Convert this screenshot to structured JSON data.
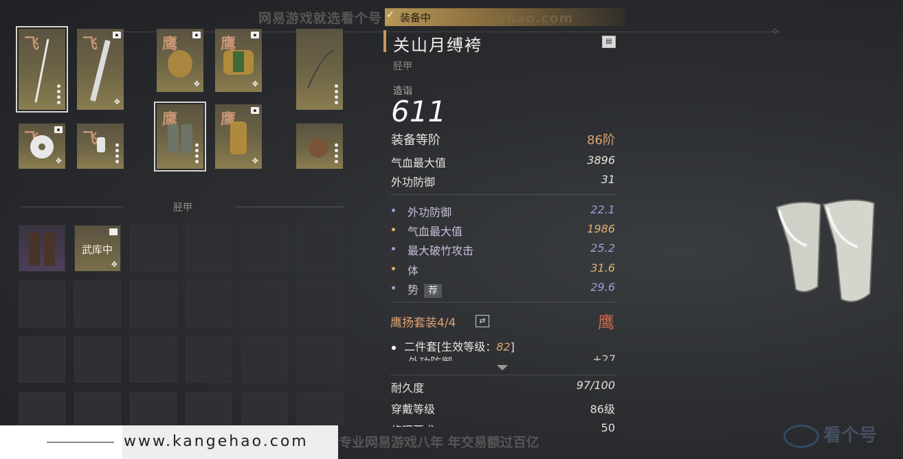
{
  "watermark_top": "网易游戏就选看个号  址：www.kangehao.com",
  "equipped_label": "装备中",
  "item": {
    "name": "关山月缚袴",
    "type": "胫甲",
    "power_label": "造诣",
    "power": "611",
    "tier_label": "装备等阶",
    "tier_value": "86阶",
    "base_stats": [
      {
        "label": "气血最大值",
        "value": "3896"
      },
      {
        "label": "外功防御",
        "value": "31"
      }
    ],
    "sub_stats": [
      {
        "label": "外功防御",
        "value": "22.1",
        "color": "#a59ad8"
      },
      {
        "label": "气血最大值",
        "value": "1986",
        "color": "#e0b070"
      },
      {
        "label": "最大破竹攻击",
        "value": "25.2",
        "color": "#a59ad8"
      },
      {
        "label": "体",
        "value": "31.6",
        "color": "#e0b070"
      },
      {
        "label": "势",
        "value": "29.6",
        "color": "#a59ad8",
        "tag": "荐"
      }
    ],
    "set_name": "鹰扬套装4/4",
    "set_mark": "鹰",
    "set_bonus_prefix": "二件套[生效等级：",
    "set_bonus_level": "82",
    "set_bonus_suffix": "]",
    "set_cut_left": "外功防御",
    "set_cut_right": "+27",
    "durability_label": "耐久度",
    "durability_value": "97/100",
    "wear_level_label": "穿戴等级",
    "wear_level_value": "86级",
    "cut_label": "修理要求",
    "cut_value": "50"
  },
  "slots": [
    {
      "mark": "飞"
    },
    {
      "mark": "飞"
    },
    {
      "mark": "鹰"
    },
    {
      "mark": "鹰"
    },
    {
      "mark": ""
    },
    {
      "mark": "飞"
    },
    {
      "mark": "飞"
    },
    {
      "mark": "鹰"
    },
    {
      "mark": "鹰"
    },
    {
      "mark": ""
    }
  ],
  "section_title": "胫甲",
  "inventory_item_caption": "武库中",
  "bottom_url": "www.kangehao.com",
  "watermark_bottom": "看个号专业网易游戏八年   年交易额过百亿",
  "logo_text": "看个号"
}
